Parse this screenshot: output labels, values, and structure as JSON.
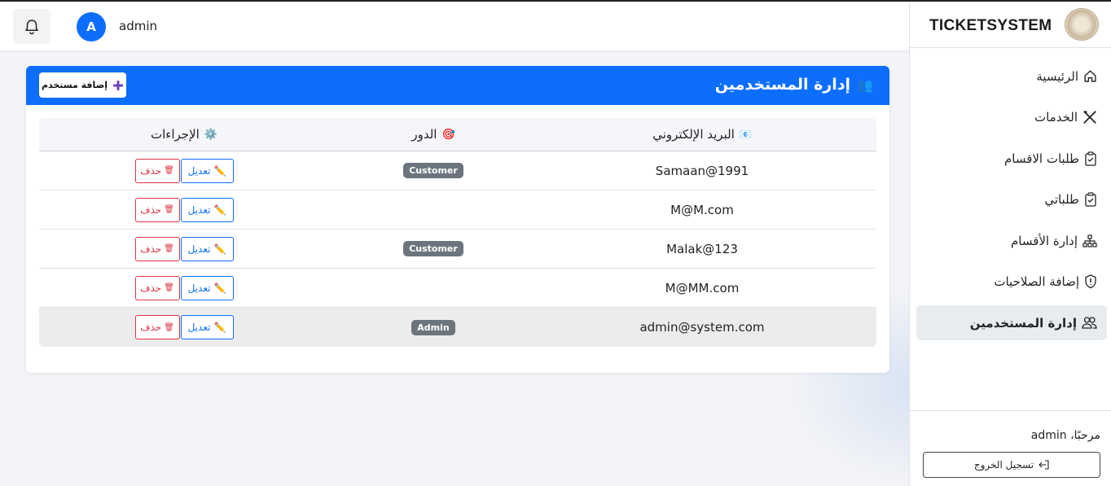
{
  "header": {
    "avatar_initial": "A",
    "user_name": "admin"
  },
  "sidebar": {
    "brand": "TICKETSYSTEM",
    "items": [
      {
        "label": "الرئيسية",
        "icon": "home-icon"
      },
      {
        "label": "الخدمات",
        "icon": "tools-icon"
      },
      {
        "label": "طلبات الاقسام",
        "icon": "clipboard-check-icon"
      },
      {
        "label": "طلباتي",
        "icon": "clipboard-check-icon"
      },
      {
        "label": "إدارة الأقسام",
        "icon": "diagram-icon"
      },
      {
        "label": "إضافة الصلاحيات",
        "icon": "shield-icon"
      },
      {
        "label": "إدارة المستخدمين",
        "icon": "people-icon",
        "active": true
      }
    ],
    "welcome": "مرحبًا، admin",
    "logout_label": "تسجيل الخروج"
  },
  "card": {
    "title": "إدارة المستخدمين",
    "title_emoji": "👥",
    "add_button_label": "إضافة مستخدم"
  },
  "table": {
    "headers": {
      "email": "البريد الإلكتروني",
      "email_emoji": "📧",
      "role": "الدور",
      "role_emoji": "🎯",
      "actions": "الإجراءات",
      "actions_emoji": "⚙️"
    },
    "edit_label": "تعديل",
    "delete_label": "حذف",
    "rows": [
      {
        "email": "Samaan@1991",
        "role": "Customer"
      },
      {
        "email": "M@M.com",
        "role": ""
      },
      {
        "email": "Malak@123",
        "role": "Customer"
      },
      {
        "email": "M@MM.com",
        "role": ""
      },
      {
        "email": "admin@system.com",
        "role": "Admin"
      }
    ]
  },
  "colors": {
    "primary": "#0d6efd",
    "danger": "#dc3545",
    "badge": "#6c757d"
  }
}
